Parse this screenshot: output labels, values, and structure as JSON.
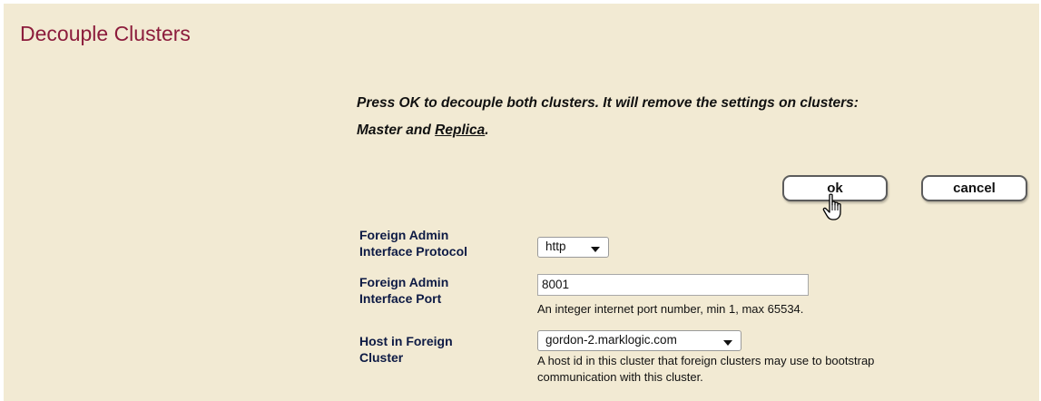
{
  "page": {
    "title": "Decouple Clusters"
  },
  "confirm": {
    "text": "Press OK to decouple both clusters. It will remove the settings on clusters:",
    "master": "Master",
    "and": "and",
    "replica": "Replica",
    "period": "."
  },
  "buttons": {
    "ok": "ok",
    "cancel": "cancel"
  },
  "form": {
    "protocol": {
      "label_line1": "Foreign Admin",
      "label_line2": "Interface Protocol",
      "value": "http"
    },
    "port": {
      "label_line1": "Foreign Admin",
      "label_line2": "Interface Port",
      "value": "8001",
      "help": "An integer internet port number, min 1, max 65534."
    },
    "host": {
      "label_line1": "Host in Foreign",
      "label_line2": "Cluster",
      "value": "gordon-2.marklogic.com",
      "help_line1": "A host id in this cluster that foreign clusters may use to bootstrap",
      "help_line2": "communication with this cluster."
    }
  },
  "icons": {
    "cursor": "hand-pointer-icon"
  },
  "colors": {
    "background": "#f2ead3",
    "title": "#8c1c3c",
    "label": "#0d1a44"
  }
}
